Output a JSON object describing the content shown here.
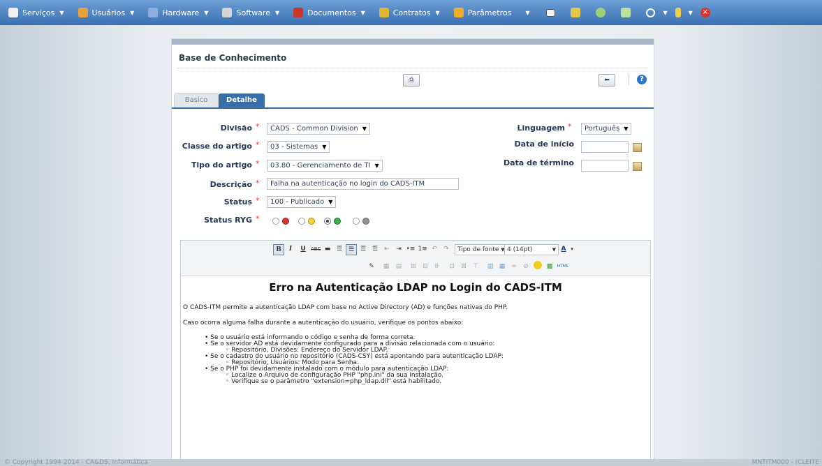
{
  "menu": {
    "items": [
      {
        "label": "Serviços",
        "icon": "services-icon",
        "color": "#f5f5f5"
      },
      {
        "label": "Usuários",
        "icon": "users-icon",
        "color": "#e8a13c"
      },
      {
        "label": "Hardware",
        "icon": "hardware-icon",
        "color": "#6b8fc7"
      },
      {
        "label": "Software",
        "icon": "software-icon",
        "color": "#d5d5d5"
      },
      {
        "label": "Documentos",
        "icon": "documents-icon",
        "color": "#c8362a"
      },
      {
        "label": "Contratos",
        "icon": "contracts-icon",
        "color": "#e0b435"
      },
      {
        "label": "Parâmetros",
        "icon": "parameters-icon",
        "color": "#eeae2a"
      }
    ]
  },
  "panel": {
    "title": "Base de Conhecimento",
    "print_icon": "print-icon",
    "back_icon": "back-arrow-icon",
    "help_label": "?"
  },
  "tabs": {
    "basico": "Basico",
    "detalhe": "Detalhe"
  },
  "form": {
    "divisao": {
      "label": "Divisão",
      "value": "CADS - Common Division"
    },
    "classe": {
      "label": "Classe do artigo",
      "value": "03 - Sistemas"
    },
    "tipo": {
      "label": "Tipo do artigo",
      "value": "03.80 - Gerenciamento de TI"
    },
    "descricao": {
      "label": "Descrição",
      "value": "Falha na autenticação no login do CADS-ITM"
    },
    "status": {
      "label": "Status",
      "value": "100 - Publicado"
    },
    "status_ryg": {
      "label": "Status RYG",
      "selected": "green"
    },
    "linguagem": {
      "label": "Linguagem",
      "value": "Português"
    },
    "data_inicio": {
      "label": "Data de início",
      "value": ""
    },
    "data_termino": {
      "label": "Data de término",
      "value": ""
    },
    "required_mark": "*",
    "dropdown_mark": "▼"
  },
  "editor": {
    "font_type": "Tipo de fonte",
    "font_size": "4 (14pt)",
    "html_label": "HTML",
    "heading": "Erro na Autenticação LDAP no Login do CADS-ITM",
    "p1": "O CADS-ITM permite a autenticação LDAP com base no Active Directory (AD) e funções nativas do PHP.",
    "p2": "Caso ocorra alguma falha durante a autenticação do usuário, verifique os pontos abaixo:",
    "list": [
      {
        "level": 1,
        "text": "Se o usuário está informando o código e senha de forma correta."
      },
      {
        "level": 1,
        "text": "Se o servidor AD está devidamente configurado para a divisão relacionada com o usuário:"
      },
      {
        "level": 2,
        "text": "Repositório, Divisões: Endereço do Servidor LDAP."
      },
      {
        "level": 1,
        "text": "Se o cadastro do usuário no repositório (CADS-CSY) está apontando para autenticação LDAP:"
      },
      {
        "level": 2,
        "text": "Repositório, Usuários: Modo para Senha."
      },
      {
        "level": 1,
        "text": "Se o PHP foi devidamente instalado com o módulo para autenticação LDAP:"
      },
      {
        "level": 2,
        "text": "Localize o Arquivo de configuração PHP \"php.ini\" da sua instalação."
      },
      {
        "level": 2,
        "text": "Verifique se o parâmetro \"extension=php_ldap.dll\" está habilitado."
      }
    ]
  },
  "footer": {
    "copyright": "© Copyright 1994-2014 - CA&DS, Informática",
    "code": "MNTITM000 - (CLEITE"
  }
}
